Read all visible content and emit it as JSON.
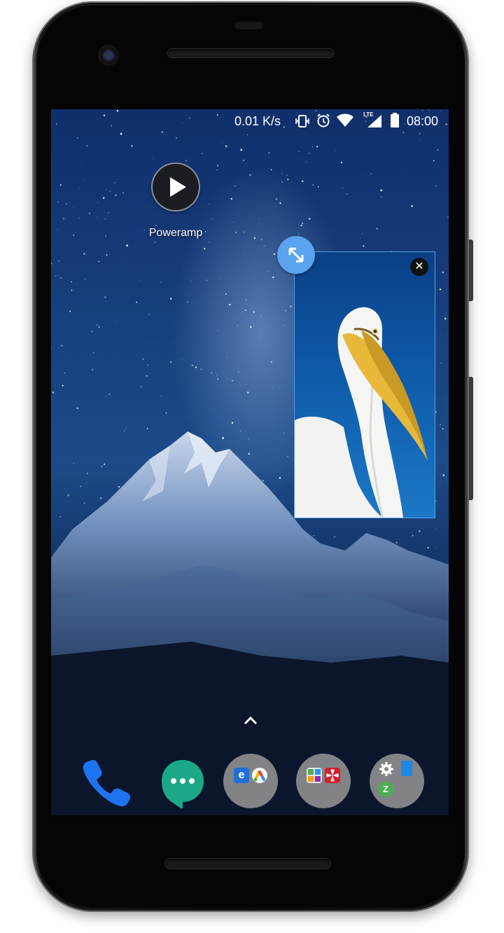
{
  "statusbar": {
    "speed": "0.01 K/s",
    "icons": [
      "vibrate-icon",
      "alarm-icon",
      "wifi-icon",
      "lte-signal-icon",
      "battery-icon"
    ],
    "lte_label": "LTE",
    "time": "08:00"
  },
  "home": {
    "apps": [
      {
        "label": "Poweramp",
        "icon": "play-icon"
      }
    ]
  },
  "pip_window": {
    "content": "pelican-video",
    "close_icon": "close-icon",
    "expand_icon": "expand-icon"
  },
  "dock": {
    "items": [
      {
        "name": "phone",
        "icon": "phone-icon"
      },
      {
        "name": "messages",
        "icon": "chat-bubble-icon"
      },
      {
        "name": "folder-1",
        "icon": "folder-icon",
        "contains": [
          "edge-icon",
          "google-ads-icon"
        ]
      },
      {
        "name": "folder-2",
        "icon": "folder-icon",
        "contains": [
          "calculator-icon",
          "huawei-icon"
        ]
      },
      {
        "name": "folder-3",
        "icon": "folder-icon",
        "contains": [
          "settings-icon",
          "blue-app-icon",
          "zarchiver-icon"
        ]
      }
    ],
    "drawer_handle_icon": "chevron-up-icon"
  },
  "colors": {
    "expand_button": "#5aa3ee",
    "pip_border": "#5b9be6",
    "messages_green": "#1aa888",
    "phone_blue": "#1e74f0"
  }
}
